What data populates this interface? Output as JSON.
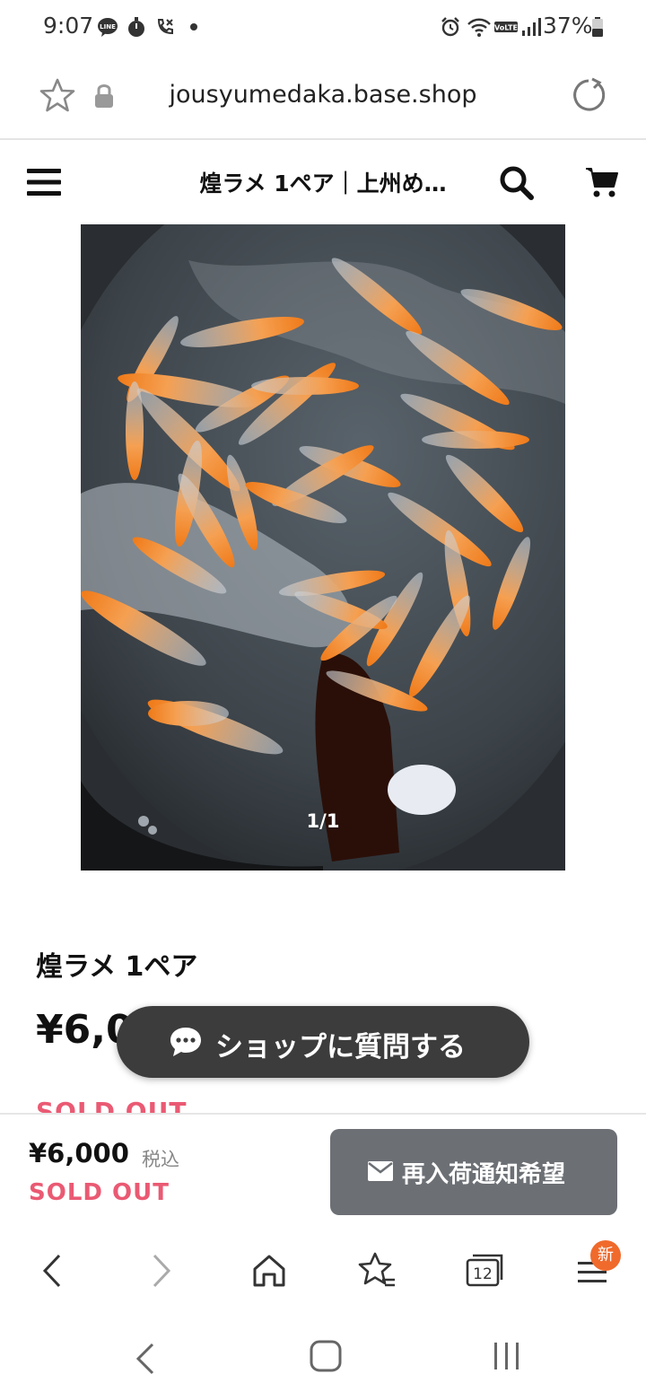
{
  "status_bar": {
    "time": "9:07",
    "battery": "37%",
    "left_icons": [
      "line-icon",
      "stopwatch-icon",
      "call-icon",
      "dot-icon"
    ],
    "right_icons": [
      "alarm-icon",
      "wifi-icon",
      "volte-icon",
      "signal-icon",
      "battery-icon"
    ]
  },
  "browser": {
    "url": "jousyumedaka.base.shop",
    "tab_count": "12",
    "menu_badge": "新"
  },
  "shop_header": {
    "title": "煌ラメ 1ペア｜上州め…"
  },
  "product": {
    "image_counter": "1/1",
    "name": "煌ラメ 1ペア",
    "price_partial": "¥6,00",
    "sold_out": "SOLD OUT"
  },
  "chat_button": {
    "label": "ショップに質問する"
  },
  "purchase_bar": {
    "price": "¥6,000",
    "tax_label": "税込",
    "sold_out": "SOLD OUT",
    "restock_label": "再入荷通知希望"
  },
  "colors": {
    "sold_out": "#ea5a73",
    "chat_pill": "#3c3c3c",
    "restock_button": "#6c7075",
    "new_badge": "#f06a2c"
  }
}
